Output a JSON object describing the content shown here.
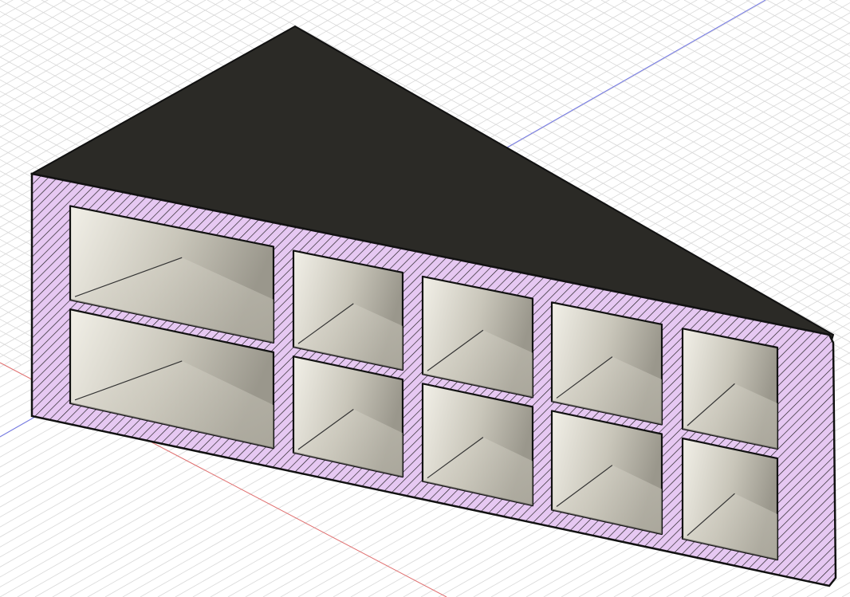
{
  "viewport": {
    "background_color": "#ffffff",
    "grid_color": "#d8d8d8",
    "x_axis_color": "#e07070",
    "y_axis_color": "#6f74e6"
  },
  "model": {
    "top_face_color": "#2b2a26",
    "section_fill_color": "#e6c8f2",
    "hatch_color": "#1c1c1c",
    "outline_color": "#111111",
    "cavity_color": "#cfccc0",
    "rows": 2,
    "columns": 5
  }
}
